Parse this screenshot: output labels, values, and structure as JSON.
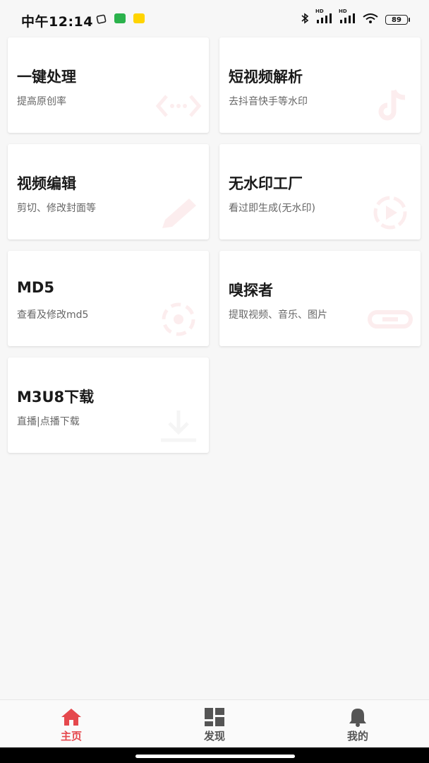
{
  "status_bar": {
    "time": "中午12:14",
    "battery": "89",
    "network_1": "HD",
    "network_2": "HD"
  },
  "cards": [
    {
      "title": "一键处理",
      "subtitle": "提高原创率",
      "icon": "code-icon"
    },
    {
      "title": "短视频解析",
      "subtitle": "去抖音快手等水印",
      "icon": "tiktok-icon"
    },
    {
      "title": "视频编辑",
      "subtitle": "剪切、修改封面等",
      "icon": "pencil-icon"
    },
    {
      "title": "无水印工厂",
      "subtitle": "看过即生成(无水印)",
      "icon": "play-icon"
    },
    {
      "title": "MD5",
      "subtitle": "查看及修改md5",
      "icon": "record-icon"
    },
    {
      "title": "嗅探者",
      "subtitle": "提取视频、音乐、图片",
      "icon": "link-icon"
    },
    {
      "title": "M3U8下载",
      "subtitle": "直播|点播下载",
      "icon": "download-icon"
    }
  ],
  "bottom_nav": {
    "items": [
      {
        "label": "主页",
        "icon": "home-icon",
        "active": true
      },
      {
        "label": "发现",
        "icon": "grid-icon",
        "active": false
      },
      {
        "label": "我的",
        "icon": "bell-icon",
        "active": false
      }
    ],
    "active_color": "#e5484d",
    "inactive_color": "#555555"
  },
  "colors": {
    "accent": "#e5484d",
    "background": "#f7f7f7"
  }
}
